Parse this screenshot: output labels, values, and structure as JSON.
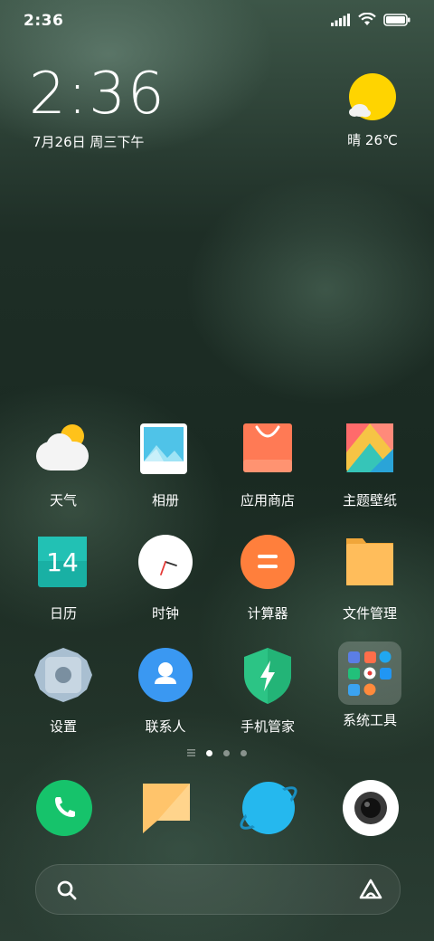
{
  "status_bar": {
    "time": "2:36"
  },
  "widget": {
    "clock": "2:36",
    "date": "7月26日 周三下午",
    "weather": "晴 26℃"
  },
  "apps": [
    {
      "name": "weather-app",
      "label": "天气",
      "icon": "weather-icon"
    },
    {
      "name": "gallery-app",
      "label": "相册",
      "icon": "gallery-icon"
    },
    {
      "name": "app-store-app",
      "label": "应用商店",
      "icon": "shopping-bag-icon"
    },
    {
      "name": "themes-app",
      "label": "主题壁纸",
      "icon": "themes-icon"
    },
    {
      "name": "calendar-app",
      "label": "日历",
      "icon": "calendar-icon",
      "day": "14"
    },
    {
      "name": "clock-app",
      "label": "时钟",
      "icon": "clock-icon"
    },
    {
      "name": "calculator-app",
      "label": "计算器",
      "icon": "calculator-icon"
    },
    {
      "name": "file-manager-app",
      "label": "文件管理",
      "icon": "folder-icon"
    },
    {
      "name": "settings-app",
      "label": "设置",
      "icon": "gear-icon"
    },
    {
      "name": "contacts-app",
      "label": "联系人",
      "icon": "contacts-icon"
    },
    {
      "name": "security-app",
      "label": "手机管家",
      "icon": "shield-icon"
    },
    {
      "name": "system-tools-folder",
      "label": "系统工具",
      "icon": "folder-grid-icon"
    }
  ],
  "dock": [
    {
      "name": "phone-app",
      "icon": "phone-icon"
    },
    {
      "name": "messages-app",
      "icon": "message-icon"
    },
    {
      "name": "browser-app",
      "icon": "browser-icon"
    },
    {
      "name": "camera-app",
      "icon": "camera-icon"
    }
  ],
  "page_indicator": {
    "pages": 3,
    "active": 1
  },
  "colors": {
    "weather_sun": "#ffd400",
    "calculator": "#ff7f3c",
    "contacts": "#3a98f2",
    "security": "#2cc485",
    "phone": "#16c36b",
    "browser": "#25b8ee",
    "calendar": "#19b0a4",
    "folder": "#ffbd5b"
  }
}
